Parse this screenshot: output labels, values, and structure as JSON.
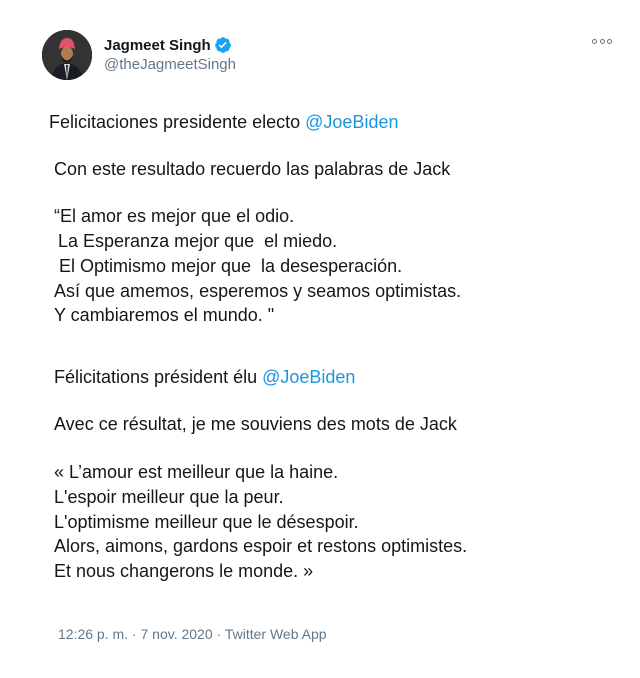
{
  "author": {
    "display_name": "Jagmeet Singh",
    "handle": "@theJagmeetSingh",
    "verified_icon": "verified-badge-icon"
  },
  "tweet": {
    "es_intro": "Felicitaciones presidente electo ",
    "es_mention": "@JoeBiden",
    "es_line2": "Con este resultado recuerdo las palabras de Jack",
    "es_quote_1": "“El amor es mejor que el odio.",
    "es_quote_2": "La Esperanza mejor que  el miedo.",
    "es_quote_3": "El Optimismo mejor que  la desesperación.",
    "es_quote_4": "Así que amemos, esperemos y seamos optimistas.",
    "es_quote_5": "Y cambiaremos el mundo. \"",
    "fr_intro": "Félicitations président élu ",
    "fr_mention": "@JoeBiden",
    "fr_line2": "Avec ce résultat, je me souviens des mots de Jack",
    "fr_quote_1": "« L’amour est meilleur que la haine.",
    "fr_quote_2": "L'espoir meilleur que la peur.",
    "fr_quote_3": "L'optimisme meilleur que le désespoir.",
    "fr_quote_4": "Alors, aimons, gardons espoir et restons optimistes.",
    "fr_quote_5": "Et nous changerons le monde. »"
  },
  "meta": {
    "time": "12:26 p. m.",
    "sep1": " · ",
    "date": "7 nov. 2020",
    "sep2": " · ",
    "source": "Twitter Web App"
  },
  "colors": {
    "link": "#1b95e0",
    "secondary": "#657786",
    "verified": "#1da1f2"
  }
}
